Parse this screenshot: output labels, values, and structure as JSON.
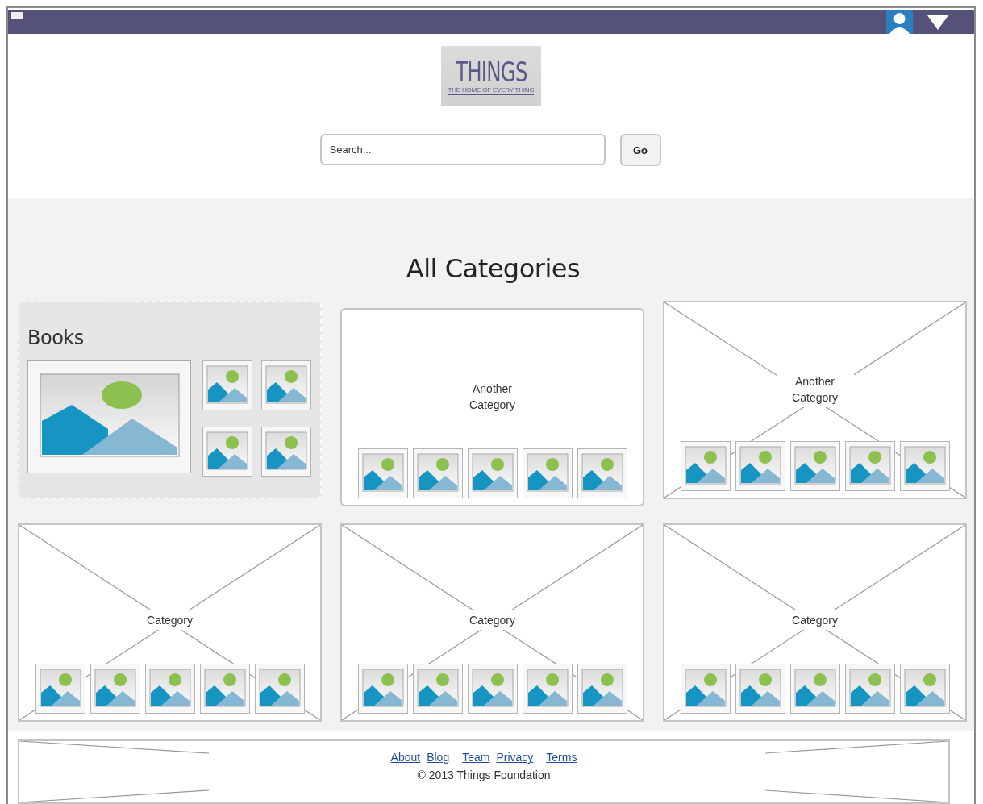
{
  "logo": {
    "title": "THINGS",
    "tagline": "THE HOME OF EVERY THING"
  },
  "search": {
    "placeholder": "Search...",
    "button": "Go"
  },
  "heading": "All Categories",
  "categories": [
    {
      "kind": "featured",
      "title": "Books"
    },
    {
      "kind": "plain",
      "title": "Another Category"
    },
    {
      "kind": "placeholder",
      "title": "Another Category"
    },
    {
      "kind": "placeholder",
      "title": "Category"
    },
    {
      "kind": "placeholder",
      "title": "Category"
    },
    {
      "kind": "placeholder",
      "title": "Category"
    }
  ],
  "footer": {
    "links": [
      "About",
      "Blog",
      "Team",
      "Privacy",
      "Terms"
    ],
    "copyright": "© 2013 Things Foundation"
  }
}
